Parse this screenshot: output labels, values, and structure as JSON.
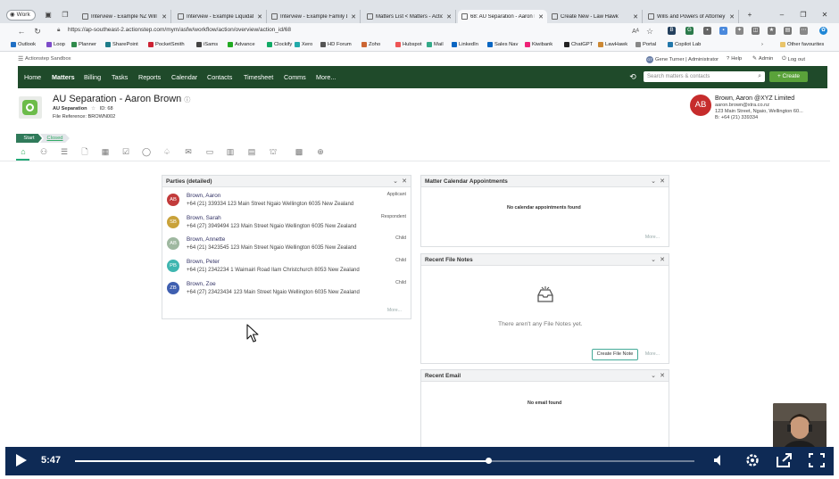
{
  "browser": {
    "profile_label": "Work",
    "tabs": [
      {
        "title": "Interview - Example NZ Will a",
        "active": false
      },
      {
        "title": "Interview - Example Liquidatic",
        "active": false
      },
      {
        "title": "Interview - Example Family Lit",
        "active": false
      },
      {
        "title": "Matters List < Matters - Action",
        "active": false
      },
      {
        "title": "68: AU Separation - Aaron Bro",
        "active": true
      },
      {
        "title": "Create New - Law Hawk",
        "active": false
      },
      {
        "title": "Wills and Powers of Attorney",
        "active": false
      }
    ],
    "new_tab": "+",
    "url": "https://ap-southeast-2.actionstep.com/mym/asfw/workflow/action/overview/action_id/68",
    "favourites": [
      "Outlook",
      "Loop",
      "Planner",
      "SharePoint",
      "PocketSmith",
      "iSams",
      "Advance",
      "Clockify",
      "Xero",
      "HD Forum",
      "Zoho",
      "Hubspot",
      "Mail",
      "LinkedIn",
      "Sales Nav",
      "Kiwibank",
      "ChatGPT",
      "LawHawk",
      "Portal",
      "Copilot Lab"
    ],
    "other_favourites": "Other favourites",
    "ext_letters": {
      "b": "B",
      "g": "G"
    }
  },
  "app": {
    "sandbox_label": "Actionstep Sandbox",
    "user_label": "Gene Turner | Administrator",
    "user_initials": "GT",
    "help_label": "Help",
    "admin_label": "Admin",
    "logout_label": "Log out"
  },
  "nav": {
    "items": [
      "Home",
      "Matters",
      "Billing",
      "Tasks",
      "Reports",
      "Calendar",
      "Contacts",
      "Timesheet",
      "Comms",
      "More..."
    ],
    "active": "Matters",
    "search_placeholder": "Search matters & contacts",
    "create_label": "+ Create"
  },
  "matter": {
    "title": "AU Separation - Aaron Brown",
    "type": "AU Separation",
    "id_label": "ID: 68",
    "file_reference": "File Reference: BROWN002"
  },
  "client": {
    "initials": "AB",
    "name": "Brown, Aaron @XYZ Limited",
    "email": "aaron.brown@xtra.co.nz",
    "address": "123 Main Street, Ngaio, Wellington 60...",
    "phone": "B: +64 (21) 339334"
  },
  "status": {
    "start": "Start",
    "closed": "Closed"
  },
  "parties": {
    "title": "Parties (detailed)",
    "more": "More...",
    "items": [
      {
        "initials": "AB",
        "color": "#c23b3b",
        "name": "Brown, Aaron",
        "detail": "+64 (21) 339334 123 Main Street Ngaio Wellington 6035 New Zealand",
        "role": "Applicant"
      },
      {
        "initials": "SB",
        "color": "#c9a23a",
        "name": "Brown, Sarah",
        "detail": "+64 (27) 3949494 123 Main Street Ngaio Wellington 6035 New Zealand",
        "role": "Respondent"
      },
      {
        "initials": "AB",
        "color": "#9fb8a0",
        "name": "Brown, Annette",
        "detail": "+64 (21) 3423545 123 Main Street Ngaio Wellington 6035 New Zealand",
        "role": "Child"
      },
      {
        "initials": "PB",
        "color": "#3fb6b0",
        "name": "Brown, Peter",
        "detail": "+64 (21) 2342234 1 Waimairi Road Ilam Christchurch 8053 New Zealand",
        "role": "Child"
      },
      {
        "initials": "ZB",
        "color": "#3f5fb0",
        "name": "Brown, Zoe",
        "detail": "+64 (27) 23423434 123 Main Street Ngaio Wellington 6035 New Zealand",
        "role": "Child"
      }
    ]
  },
  "calendar": {
    "title": "Matter Calendar Appointments",
    "empty": "No calendar appointments found",
    "more": "More..."
  },
  "filenotes": {
    "title": "Recent File Notes",
    "empty": "There aren't any File Notes yet.",
    "create_label": "Create File Note",
    "more": "More..."
  },
  "email": {
    "title": "Recent Email",
    "empty": "No email found"
  },
  "video": {
    "time": "5:47",
    "progress": 0.667
  }
}
